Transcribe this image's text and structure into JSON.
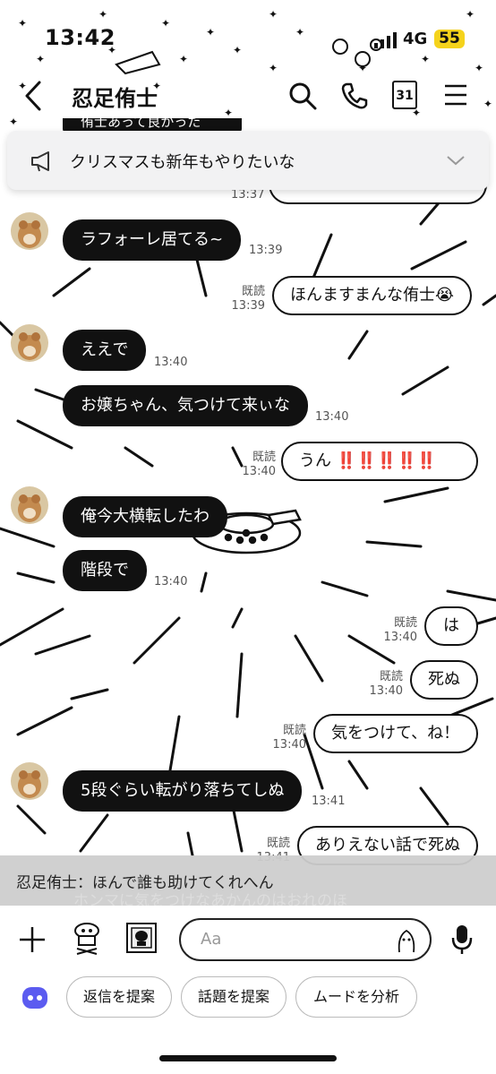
{
  "status": {
    "time": "13:42",
    "network": "4G",
    "battery": "55"
  },
  "header": {
    "title": "忍足侑士",
    "icons": [
      "back-icon",
      "search-icon",
      "phone-icon",
      "calendar-icon",
      "menu-icon"
    ],
    "calendar_day": "31"
  },
  "notice": {
    "text": "クリスマスも新年もやりたいな",
    "icon": "megaphone-icon"
  },
  "top_cutoff": {
    "text": "侑士あって良かった",
    "time": "13:37"
  },
  "messages": [
    {
      "side": "in",
      "text": "ラフォーレ居てる~",
      "time": "13:39"
    },
    {
      "side": "out",
      "text": "ほんますまんな侑士😭",
      "read": "既読",
      "time": "13:39"
    },
    {
      "side": "in",
      "text": "ええで",
      "time": "13:40"
    },
    {
      "side": "in",
      "text": "お嬢ちゃん、気つけて来ぃな",
      "time": "13:40"
    },
    {
      "side": "out",
      "text": "うん",
      "emphasis": "‼️‼️‼️‼️‼️",
      "read": "既読",
      "time": "13:40"
    },
    {
      "side": "in",
      "text": "俺今大横転したわ"
    },
    {
      "side": "in",
      "text": "階段で",
      "time": "13:40"
    },
    {
      "side": "out",
      "text": "は",
      "read": "既読",
      "time": "13:40"
    },
    {
      "side": "out",
      "text": "死ぬ",
      "read": "既読",
      "time": "13:40"
    },
    {
      "side": "out",
      "text": "気をつけて、ね！",
      "read": "既読",
      "time": "13:40"
    },
    {
      "side": "in",
      "text": "5段ぐらい転がり落ちてしぬ",
      "time": "13:41"
    },
    {
      "side": "out",
      "text": "ありえない話で死ぬ",
      "read": "既読",
      "time": "13:41"
    }
  ],
  "preview": {
    "text": "忍足侑士：ほんで誰も助けてくれへん",
    "ghost": "ホンマに気をつけなあかんのはおれのほ"
  },
  "input": {
    "placeholder": "Aa",
    "icons": [
      "plus-icon",
      "sticker-icon",
      "photo-icon",
      "emoji-icon",
      "mic-icon"
    ]
  },
  "suggestions": {
    "icon": "ai-assistant-icon",
    "chips": [
      "返信を提案",
      "話題を提案",
      "ムードを分析"
    ]
  },
  "colors": {
    "bubble_in": "#111111",
    "bubble_out": "#ffffff",
    "battery": "#f5d31c",
    "ai_icon": "#5b5bf0"
  }
}
